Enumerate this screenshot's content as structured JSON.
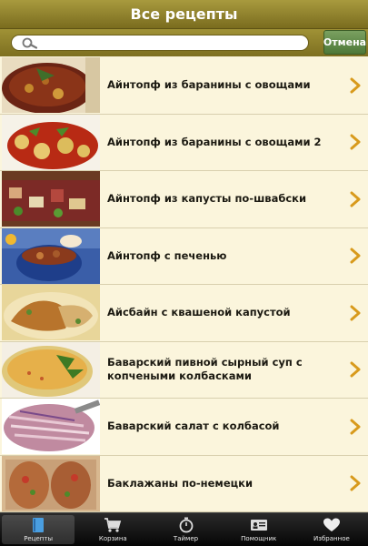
{
  "header": {
    "title": "Все рецепты"
  },
  "search": {
    "value": "",
    "placeholder": "",
    "cancel_label": "Отмена"
  },
  "recipes": [
    {
      "name": "Айнтопф из баранины с овощами",
      "image": "stew-dish"
    },
    {
      "name": "Айнтопф из баранины с овощами 2",
      "image": "stew-vegetables-dish"
    },
    {
      "name": "Айнтопф из капусты по-швабски",
      "image": "cabbage-stew-dish"
    },
    {
      "name": "Айнтопф с печенью",
      "image": "liver-stew-pot"
    },
    {
      "name": "Айсбайн с квашеной капустой",
      "image": "pork-knuckle-dish"
    },
    {
      "name": "Баварский пивной сырный суп с копчеными колбасками",
      "image": "cheese-soup-bowl"
    },
    {
      "name": "Баварский салат с колбасой",
      "image": "sausage-salad-plate"
    },
    {
      "name": "Баклажаны по-немецки",
      "image": "baked-eggplant-dish"
    }
  ],
  "tabs": [
    {
      "label": "Рецепты",
      "icon": "book-icon",
      "active": true
    },
    {
      "label": "Корзина",
      "icon": "cart-icon",
      "active": false
    },
    {
      "label": "Таймер",
      "icon": "timer-icon",
      "active": false
    },
    {
      "label": "Помощник",
      "icon": "contact-card-icon",
      "active": false
    },
    {
      "label": "Избранное",
      "icon": "heart-icon",
      "active": false
    }
  ],
  "colors": {
    "header": "#8a7c2c",
    "cancel": "#5e8a46",
    "list_bg": "#fbf5dc",
    "chevron": "#d89a1c",
    "tabbar": "#111111"
  }
}
